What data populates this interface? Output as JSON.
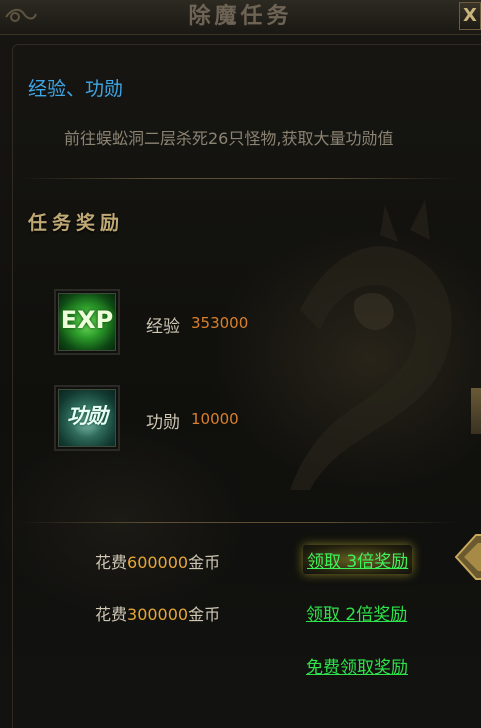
{
  "window": {
    "title": "除魔任务",
    "close_label": "X"
  },
  "task": {
    "name": "经验、功勋",
    "description": "前往蜈蚣洞二层杀死26只怪物,获取大量功勋值"
  },
  "rewards": {
    "section_title": "任务奖励",
    "items": [
      {
        "icon": "exp-icon",
        "icon_text": "EXP",
        "label": "经验",
        "value": "353000"
      },
      {
        "icon": "merit-icon",
        "icon_text": "功勋",
        "label": "功勋",
        "value": "10000"
      }
    ]
  },
  "claims": [
    {
      "cost_prefix": "花费",
      "cost_amount": "600000",
      "cost_suffix": "金币",
      "action": "领取 3倍奖励",
      "highlighted": true
    },
    {
      "cost_prefix": "花费",
      "cost_amount": "300000",
      "cost_suffix": "金币",
      "action": "领取 2倍奖励",
      "highlighted": false
    },
    {
      "action": "免费领取奖励",
      "highlighted": false
    }
  ],
  "colors": {
    "task_name": "#3fa6e6",
    "section_title": "#bfa874",
    "reward_value": "#d9802c",
    "cost_amount": "#e6a63a",
    "claim_link": "#2ee34a"
  }
}
